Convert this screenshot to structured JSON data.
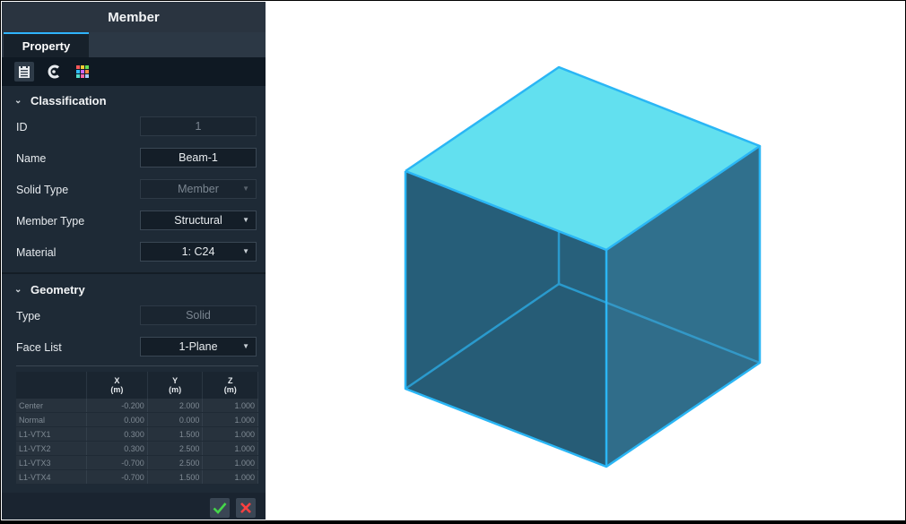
{
  "panel": {
    "title": "Member",
    "tab": "Property",
    "icons": [
      "properties-icon",
      "curve-icon",
      "palette-icon"
    ]
  },
  "classification": {
    "title": "Classification",
    "id": {
      "label": "ID",
      "value": "1"
    },
    "name": {
      "label": "Name",
      "value": "Beam-1"
    },
    "solid_type": {
      "label": "Solid Type",
      "value": "Member"
    },
    "member_type": {
      "label": "Member Type",
      "value": "Structural"
    },
    "material": {
      "label": "Material",
      "value": "1: C24"
    }
  },
  "geometry": {
    "title": "Geometry",
    "type": {
      "label": "Type",
      "value": "Solid"
    },
    "face_list": {
      "label": "Face List",
      "value": "1-Plane"
    },
    "table": {
      "headers": [
        {
          "axis": "X",
          "unit": "(m)"
        },
        {
          "axis": "Y",
          "unit": "(m)"
        },
        {
          "axis": "Z",
          "unit": "(m)"
        }
      ],
      "rows": [
        {
          "label": "Center",
          "x": "-0.200",
          "y": "2.000",
          "z": "1.000"
        },
        {
          "label": "Normal",
          "x": "0.000",
          "y": "0.000",
          "z": "1.000"
        },
        {
          "label": "L1-VTX1",
          "x": "0.300",
          "y": "1.500",
          "z": "1.000"
        },
        {
          "label": "L1-VTX2",
          "x": "0.300",
          "y": "2.500",
          "z": "1.000"
        },
        {
          "label": "L1-VTX3",
          "x": "-0.700",
          "y": "2.500",
          "z": "1.000"
        },
        {
          "label": "L1-VTX4",
          "x": "-0.700",
          "y": "1.500",
          "z": "1.000"
        }
      ]
    }
  },
  "colors": {
    "top_face": "#62e0ef",
    "side_face": "#26607a",
    "front_face": "#2e6f8c",
    "edge": "#2ab6f5"
  }
}
